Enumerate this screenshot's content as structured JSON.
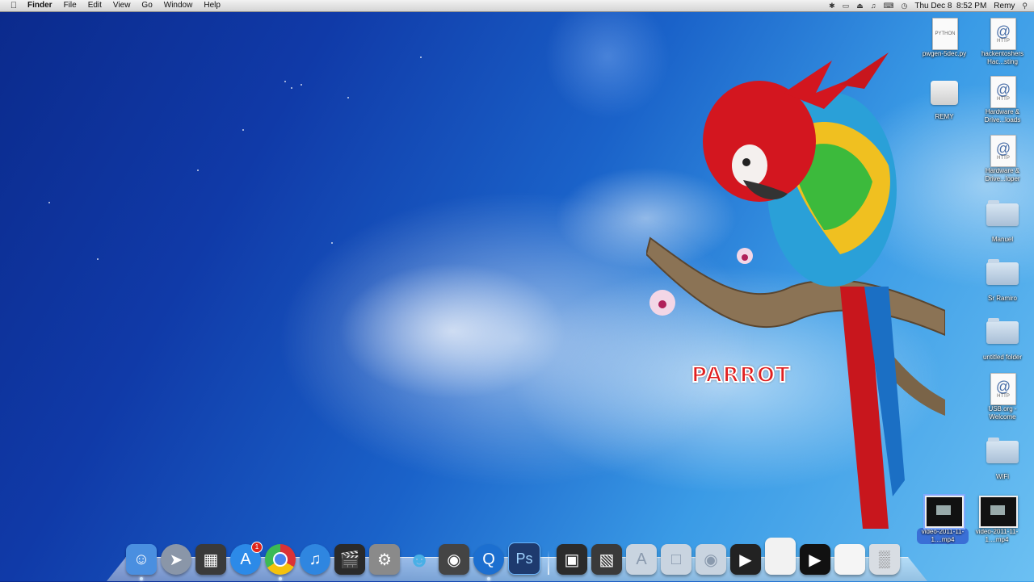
{
  "menubar": {
    "apple_icon": "apple-logo",
    "app_name": "Finder",
    "menus": [
      "File",
      "Edit",
      "View",
      "Go",
      "Window",
      "Help"
    ],
    "status_icons": [
      "bluetooth-icon",
      "airplay-icon",
      "eject-icon",
      "volume-icon",
      "keyboard-icon",
      "time-machine-icon"
    ],
    "clock": "Thu Dec 8  8:52 PM",
    "user": "Remy",
    "search_icon": "spotlight-icon"
  },
  "wallpaper": {
    "logo_text": "PARROT"
  },
  "desktop_icons": [
    {
      "label": "pwgen-5dec.py",
      "kind": "python-file",
      "tag": "PYTHON"
    },
    {
      "label": "hackentoshers Hac...sting",
      "kind": "webloc",
      "tag": "HTTP"
    },
    {
      "label": "REMY",
      "kind": "disk"
    },
    {
      "label": "Hardware & Drive...loads",
      "kind": "webloc",
      "tag": "HTTP"
    },
    {
      "label": "Hardware & Drive...loper",
      "kind": "webloc",
      "tag": "HTTP"
    },
    {
      "label": "Manuel",
      "kind": "folder"
    },
    {
      "label": "Sr Ramiro",
      "kind": "folder"
    },
    {
      "label": "untitled folder",
      "kind": "folder"
    },
    {
      "label": "USB.org - Welcome",
      "kind": "webloc",
      "tag": "HTTP"
    },
    {
      "label": "WiFi",
      "kind": "folder"
    },
    {
      "label": "video-2011-11-1....mp4",
      "kind": "video",
      "selected": true
    },
    {
      "label": "video-2011-11-1....mp4",
      "kind": "video",
      "selected": false
    }
  ],
  "dock": {
    "apps": [
      {
        "name": "Finder",
        "icon": "finder-icon",
        "color": "#4a8fe0",
        "running": true
      },
      {
        "name": "Launchpad",
        "icon": "launchpad-icon",
        "color": "#8a96a8",
        "running": false
      },
      {
        "name": "Mission Control",
        "icon": "mission-control-icon",
        "color": "#3a3a3a",
        "running": false
      },
      {
        "name": "App Store",
        "icon": "app-store-icon",
        "color": "#2c8ae8",
        "running": false,
        "badge": "1"
      },
      {
        "name": "Google Chrome",
        "icon": "chrome-icon",
        "color": "#e8e8e8",
        "running": true
      },
      {
        "name": "iTunes",
        "icon": "itunes-icon",
        "color": "#2f86e0",
        "running": false
      },
      {
        "name": "Final Cut Pro",
        "icon": "final-cut-icon",
        "color": "#2a2a2a",
        "running": false
      },
      {
        "name": "System Preferences",
        "icon": "system-preferences-icon",
        "color": "#8a8a8a",
        "running": false
      },
      {
        "name": "Messenger",
        "icon": "messenger-icon",
        "color": "#49b0e6",
        "running": false
      },
      {
        "name": "FaceTime",
        "icon": "facetime-icon",
        "color": "#444",
        "running": false
      },
      {
        "name": "QuickTime Player",
        "icon": "quicktime-icon",
        "color": "#1c6fd0",
        "running": true
      },
      {
        "name": "Photoshop",
        "icon": "photoshop-icon",
        "color": "#1e3a6e",
        "running": false
      }
    ],
    "stacks": [
      {
        "name": "Screenshot",
        "icon": "image-stack-icon",
        "color": "#2b2b2b"
      },
      {
        "name": "Folder",
        "icon": "folder-stack-icon",
        "color": "#3a3a3a"
      },
      {
        "name": "Applications",
        "icon": "applications-stack-icon",
        "color": "#c9d4e0"
      },
      {
        "name": "Documents",
        "icon": "documents-stack-icon",
        "color": "#c9d4e0"
      },
      {
        "name": "Downloads",
        "icon": "downloads-stack-icon",
        "color": "#c9d4e0"
      },
      {
        "name": "Video",
        "icon": "video-stack-icon",
        "color": "#222"
      },
      {
        "name": "Document",
        "icon": "document-stack-icon",
        "color": "#f2f2f2"
      },
      {
        "name": "Video",
        "icon": "video-stack-icon",
        "color": "#111"
      },
      {
        "name": "Document",
        "icon": "document-stack-icon",
        "color": "#f5f5f5"
      },
      {
        "name": "Trash",
        "icon": "trash-icon",
        "color": "#d8dde3"
      }
    ],
    "ps_label": "Ps"
  }
}
